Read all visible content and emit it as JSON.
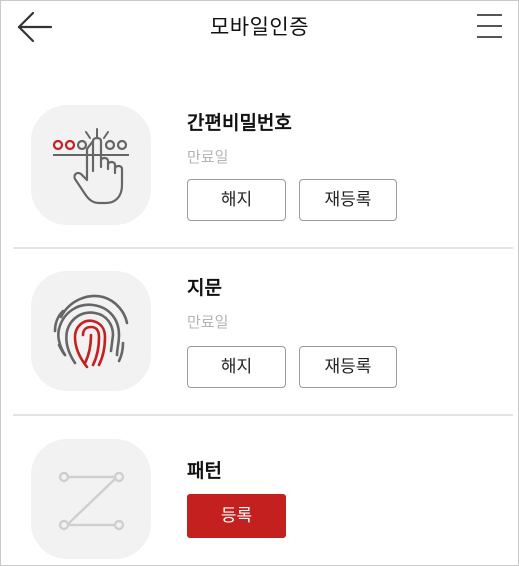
{
  "header": {
    "title": "모바일인증",
    "back_icon": "arrow-left-icon",
    "menu_icon": "hamburger-menu-icon"
  },
  "methods": [
    {
      "title": "간편비밀번호",
      "expiry_label": "만료일",
      "icon": "pin-touch-icon",
      "buttons": {
        "cancel": "해지",
        "reregister": "재등록"
      }
    },
    {
      "title": "지문",
      "expiry_label": "만료일",
      "icon": "fingerprint-icon",
      "buttons": {
        "cancel": "해지",
        "reregister": "재등록"
      }
    },
    {
      "title": "패턴",
      "icon": "pattern-z-icon",
      "buttons": {
        "register": "등록"
      }
    }
  ],
  "colors": {
    "accent": "#c42020",
    "icon_gray": "#666666",
    "icon_bg": "#f2f2f2",
    "muted_text": "#b4b4b4"
  }
}
